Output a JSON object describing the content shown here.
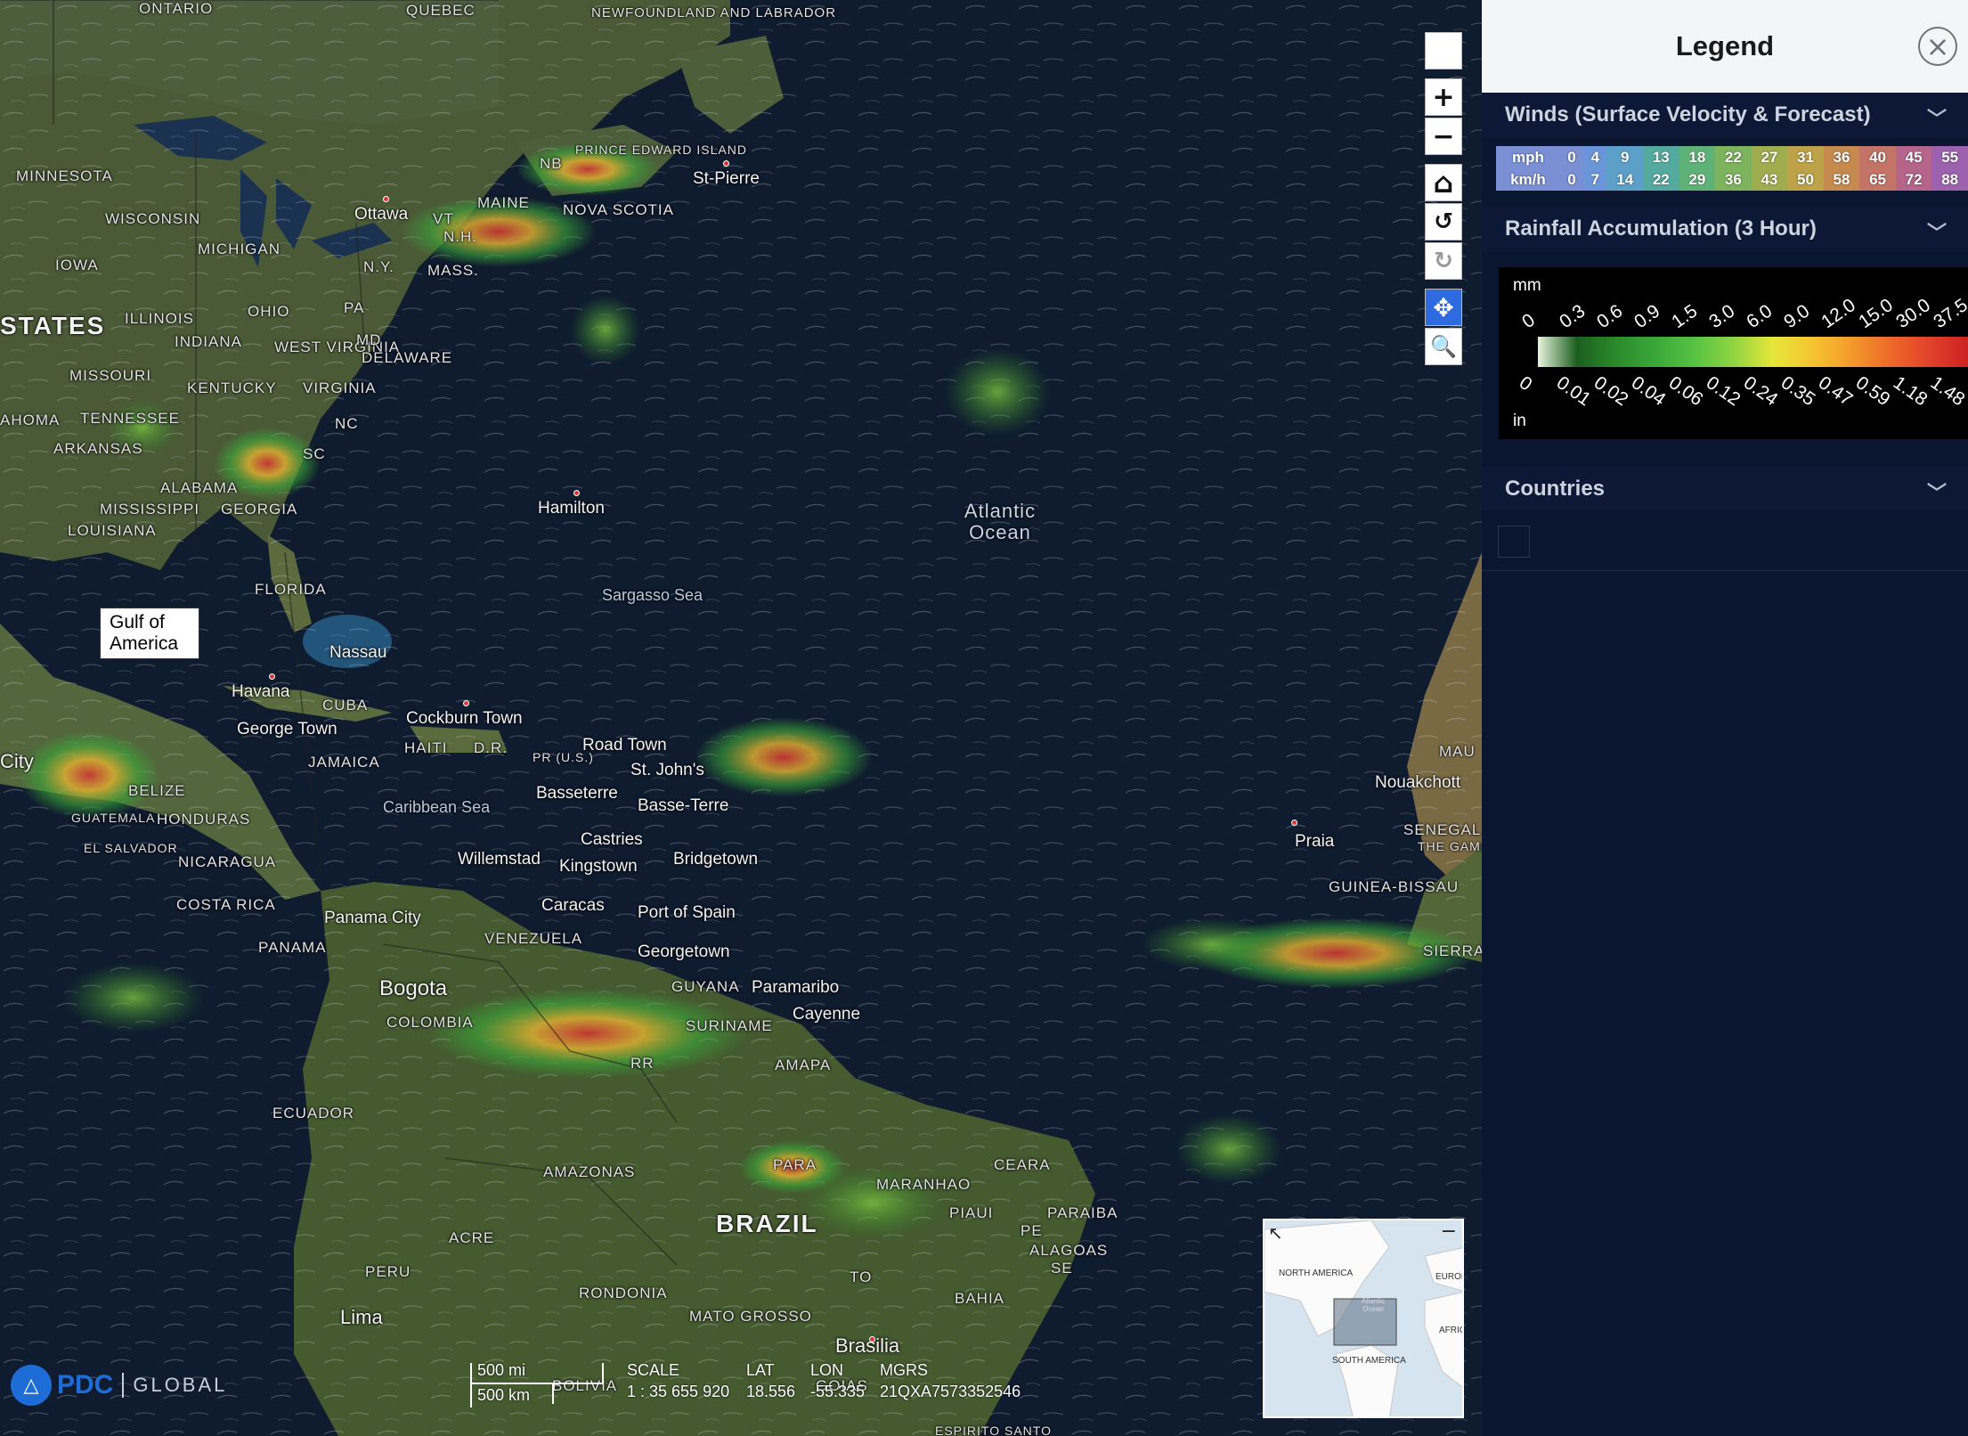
{
  "map": {
    "gulf_label": [
      "Gulf of",
      "America"
    ],
    "places": [
      {
        "text": "ONTARIO",
        "cls": "caps"
      },
      {
        "text": "QUEBEC",
        "cls": "caps"
      },
      {
        "text": "NEWFOUNDLAND AND LABRADOR",
        "cls": "caps"
      },
      {
        "text": "MINNESOTA",
        "cls": "caps"
      },
      {
        "text": "WISCONSIN",
        "cls": "caps"
      },
      {
        "text": "MICHIGAN",
        "cls": "caps"
      },
      {
        "text": "IOWA",
        "cls": "caps"
      },
      {
        "text": "STATES",
        "cls": "big"
      },
      {
        "text": "ILLINOIS",
        "cls": "caps"
      },
      {
        "text": "OHIO",
        "cls": "caps"
      },
      {
        "text": "PA",
        "cls": "caps"
      },
      {
        "text": "N.Y.",
        "cls": "caps"
      },
      {
        "text": "INDIANA",
        "cls": "caps"
      },
      {
        "text": "MISSOURI",
        "cls": "caps"
      },
      {
        "text": "WEST VIRGINIA",
        "cls": "caps"
      },
      {
        "text": "KENTUCKY",
        "cls": "caps"
      },
      {
        "text": "VIRGINIA",
        "cls": "caps"
      },
      {
        "text": "MD",
        "cls": "caps"
      },
      {
        "text": "DELAWARE",
        "cls": "caps"
      },
      {
        "text": "TENNESSEE",
        "cls": "caps"
      },
      {
        "text": "AHOMA",
        "cls": "caps"
      },
      {
        "text": "ARKANSAS",
        "cls": "caps"
      },
      {
        "text": "NC",
        "cls": "caps"
      },
      {
        "text": "SC",
        "cls": "caps"
      },
      {
        "text": "ALABAMA",
        "cls": "caps"
      },
      {
        "text": "GEORGIA",
        "cls": "caps"
      },
      {
        "text": "MISSISSIPPI",
        "cls": "caps"
      },
      {
        "text": "LOUISIANA",
        "cls": "caps"
      },
      {
        "text": "FLORIDA",
        "cls": "caps"
      },
      {
        "text": "Ottawa",
        "cls": ""
      },
      {
        "text": "VT",
        "cls": "caps"
      },
      {
        "text": "MAINE",
        "cls": "caps"
      },
      {
        "text": "N.H.",
        "cls": "caps"
      },
      {
        "text": "MASS.",
        "cls": "caps"
      },
      {
        "text": "NB",
        "cls": "caps"
      },
      {
        "text": "PRINCE EDWARD ISLAND",
        "cls": "caps"
      },
      {
        "text": "NOVA SCOTIA",
        "cls": "caps"
      },
      {
        "text": "St-Pierre",
        "cls": ""
      },
      {
        "text": "Hamilton",
        "cls": ""
      },
      {
        "text": "Atlantic Ocean",
        "cls": "ocean"
      },
      {
        "text": "Sargasso Sea",
        "cls": "sea"
      },
      {
        "text": "Nassau",
        "cls": ""
      },
      {
        "text": "Havana",
        "cls": ""
      },
      {
        "text": "CUBA",
        "cls": "caps"
      },
      {
        "text": "George Town",
        "cls": ""
      },
      {
        "text": "Cockburn Town",
        "cls": ""
      },
      {
        "text": "JAMAICA",
        "cls": "caps"
      },
      {
        "text": "HAITI",
        "cls": "caps"
      },
      {
        "text": "D.R.",
        "cls": "caps"
      },
      {
        "text": "PR (U.S.)",
        "cls": "caps"
      },
      {
        "text": "Road Town",
        "cls": ""
      },
      {
        "text": "St. John's",
        "cls": ""
      },
      {
        "text": "Basseterre",
        "cls": ""
      },
      {
        "text": "Basse-Terre",
        "cls": ""
      },
      {
        "text": "City",
        "cls": ""
      },
      {
        "text": "BELIZE",
        "cls": "caps"
      },
      {
        "text": "GUATEMALA",
        "cls": "caps"
      },
      {
        "text": "HONDURAS",
        "cls": "caps"
      },
      {
        "text": "EL SALVADOR",
        "cls": "caps"
      },
      {
        "text": "NICARAGUA",
        "cls": "caps"
      },
      {
        "text": "Caribbean Sea",
        "cls": "sea"
      },
      {
        "text": "Castries",
        "cls": ""
      },
      {
        "text": "Willemstad",
        "cls": ""
      },
      {
        "text": "Kingstown",
        "cls": ""
      },
      {
        "text": "Bridgetown",
        "cls": ""
      },
      {
        "text": "COSTA RICA",
        "cls": "caps"
      },
      {
        "text": "Panama City",
        "cls": ""
      },
      {
        "text": "Caracas",
        "cls": ""
      },
      {
        "text": "Port of Spain",
        "cls": ""
      },
      {
        "text": "PANAMA",
        "cls": "caps"
      },
      {
        "text": "VENEZUELA",
        "cls": "caps"
      },
      {
        "text": "Georgetown",
        "cls": ""
      },
      {
        "text": "Bogota",
        "cls": ""
      },
      {
        "text": "GUYANA",
        "cls": "caps"
      },
      {
        "text": "Paramaribo",
        "cls": ""
      },
      {
        "text": "Cayenne",
        "cls": ""
      },
      {
        "text": "SURINAME",
        "cls": "caps"
      },
      {
        "text": "COLOMBIA",
        "cls": "caps"
      },
      {
        "text": "RR",
        "cls": "caps"
      },
      {
        "text": "AMAPA",
        "cls": "caps"
      },
      {
        "text": "ECUADOR",
        "cls": "caps"
      },
      {
        "text": "AMAZONAS",
        "cls": "caps"
      },
      {
        "text": "PARA",
        "cls": "caps"
      },
      {
        "text": "MARANHAO",
        "cls": "caps"
      },
      {
        "text": "CEARA",
        "cls": "caps"
      },
      {
        "text": "PIAUI",
        "cls": "caps"
      },
      {
        "text": "BRAZIL",
        "cls": "big"
      },
      {
        "text": "PARAIBA",
        "cls": "caps"
      },
      {
        "text": "PE",
        "cls": "caps"
      },
      {
        "text": "ACRE",
        "cls": "caps"
      },
      {
        "text": "ALAGOAS",
        "cls": "caps"
      },
      {
        "text": "SE",
        "cls": "caps"
      },
      {
        "text": "PERU",
        "cls": "caps"
      },
      {
        "text": "TO",
        "cls": "caps"
      },
      {
        "text": "BAHIA",
        "cls": "caps"
      },
      {
        "text": "RONDONIA",
        "cls": "caps"
      },
      {
        "text": "MATO GROSSO",
        "cls": "caps"
      },
      {
        "text": "Lima",
        "cls": ""
      },
      {
        "text": "Brasilia",
        "cls": ""
      },
      {
        "text": "BOLIVIA",
        "cls": "caps"
      },
      {
        "text": "GOIAS",
        "cls": "caps"
      },
      {
        "text": "Praia",
        "cls": ""
      },
      {
        "text": "MAU",
        "cls": "caps"
      },
      {
        "text": "Nouakchott",
        "cls": ""
      },
      {
        "text": "SENEGAL",
        "cls": "caps"
      },
      {
        "text": "THE GAMBIA",
        "cls": "caps"
      },
      {
        "text": "GUINEA-BISSAU",
        "cls": "caps"
      },
      {
        "text": "SIERRA",
        "cls": "caps"
      },
      {
        "text": "ESPIRITO SANTO",
        "cls": "caps"
      }
    ]
  },
  "toolbar": {
    "icons": [
      "blank-icon",
      "zoom-in-icon",
      "zoom-out-icon",
      "home-icon",
      "undo-icon",
      "redo-icon",
      "pan-icon",
      "zoom-box-icon"
    ],
    "glyphs": [
      "",
      "+",
      "−",
      "⌂",
      "↺",
      "↻",
      "✥",
      "🔍"
    ]
  },
  "legend": {
    "title": "Legend",
    "close_glyph": "×",
    "sections": {
      "winds": "Winds (Surface Velocity & Forecast)",
      "rainfall": "Rainfall Accumulation (3 Hour)",
      "countries": "Countries"
    },
    "chevron": "﹀",
    "wind_scale": {
      "mph_label": "mph",
      "kmh_label": "km/h",
      "mph": [
        "0",
        "4",
        "9",
        "13",
        "18",
        "22",
        "27",
        "31",
        "36",
        "40",
        "45",
        "55"
      ],
      "kmh": [
        "0",
        "7",
        "14",
        "22",
        "29",
        "36",
        "43",
        "50",
        "58",
        "65",
        "72",
        "88"
      ],
      "colors": [
        "#7a8fd4",
        "#6b95d8",
        "#5c9fc8",
        "#55aaa0",
        "#5fb277",
        "#7cb35c",
        "#a0ad4e",
        "#bda249",
        "#c6894e",
        "#c37466",
        "#b5648a",
        "#9d62ad"
      ]
    },
    "rain_scale": {
      "mm_label": "mm",
      "in_label": "in",
      "mm": [
        "0",
        "0.3",
        "0.6",
        "0.9",
        "1.5",
        "3.0",
        "6.0",
        "9.0",
        "12.0",
        "15.0",
        "30.0",
        "37.5"
      ],
      "in": [
        "0",
        "0.01",
        "0.02",
        "0.04",
        "0.06",
        "0.12",
        "0.24",
        "0.35",
        "0.47",
        "0.59",
        "1.18",
        "1.48"
      ],
      "colors": [
        "#e6f4dc",
        "#1c5e1f",
        "#2a8a2a",
        "#3aa83a",
        "#56c243",
        "#8fd441",
        "#e6e63a",
        "#f6c531",
        "#f49b2c",
        "#ee6a2a",
        "#e2422a",
        "#cc2222"
      ]
    }
  },
  "status": {
    "brand": "PDC",
    "brand_sub": "GLOBAL",
    "scale_mi": "500 mi",
    "scale_km": "500 km",
    "scale_key": "SCALE",
    "scale_val": "1 : 35 655 920",
    "lat_key": "LAT",
    "lat_val": "18.556",
    "lon_key": "LON",
    "lon_val": "-55.335",
    "mgrs_key": "MGRS",
    "mgrs_val": "21QXA7573352546"
  },
  "overview": {
    "labels": [
      "NORTH AMERICA",
      "Atlantic Ocean",
      "EUROP",
      "AFRIC",
      "SOUTH AMERICA"
    ]
  }
}
